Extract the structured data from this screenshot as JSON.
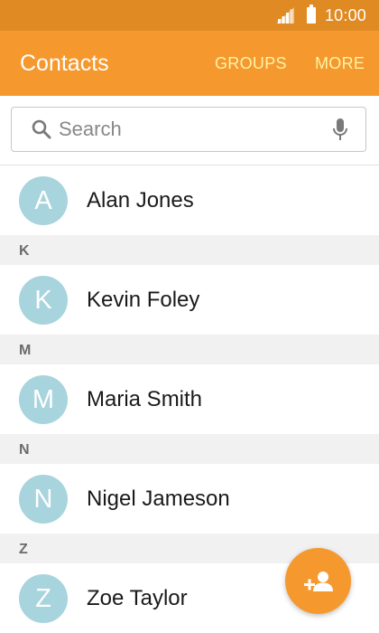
{
  "status_bar": {
    "time": "10:00",
    "icons": [
      "signal-icon",
      "battery-icon"
    ]
  },
  "app_bar": {
    "title": "Contacts",
    "actions": [
      "GROUPS",
      "MORE"
    ]
  },
  "search": {
    "placeholder": "Search",
    "value": ""
  },
  "contacts": [
    {
      "type": "contact",
      "initial": "A",
      "name": "Alan Jones"
    },
    {
      "type": "header",
      "letter": "K"
    },
    {
      "type": "contact",
      "initial": "K",
      "name": "Kevin Foley"
    },
    {
      "type": "header",
      "letter": "M"
    },
    {
      "type": "contact",
      "initial": "M",
      "name": "Maria Smith"
    },
    {
      "type": "header",
      "letter": "N"
    },
    {
      "type": "contact",
      "initial": "N",
      "name": "Nigel Jameson"
    },
    {
      "type": "header",
      "letter": "Z"
    },
    {
      "type": "contact",
      "initial": "Z",
      "name": "Zoe Taylor"
    }
  ],
  "fab": {
    "icon": "add-contact-icon"
  },
  "colors": {
    "status_bar": "#e08a24",
    "app_bar": "#f5992f",
    "action_text": "#fff3a6",
    "avatar": "#a8d4dd",
    "section_bg": "#f1f1f1"
  }
}
